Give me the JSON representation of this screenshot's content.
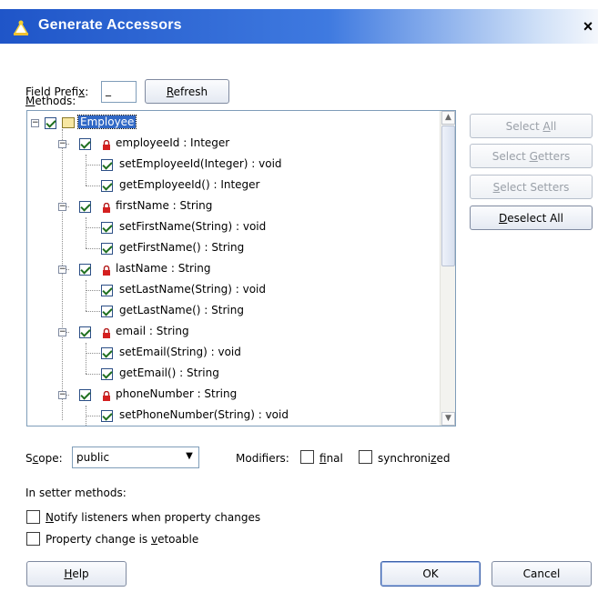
{
  "window": {
    "title": "Generate Accessors",
    "close_glyph": "×"
  },
  "field_prefix": {
    "label_before": "Field Prefi",
    "label_mn": "x",
    "label_after": ":",
    "value": "_"
  },
  "refresh_button": {
    "mn": "R",
    "rest": "efresh"
  },
  "methods_label": {
    "mn": "M",
    "rest": "ethods:"
  },
  "tree": {
    "root": {
      "label": "Employee",
      "checked": true
    },
    "fields": [
      {
        "label": "employeeId : Integer",
        "methods": [
          "setEmployeeId(Integer) : void",
          "getEmployeeId() : Integer"
        ]
      },
      {
        "label": "firstName : String",
        "methods": [
          "setFirstName(String) : void",
          "getFirstName() : String"
        ]
      },
      {
        "label": "lastName : String",
        "methods": [
          "setLastName(String) : void",
          "getLastName() : String"
        ]
      },
      {
        "label": "email : String",
        "methods": [
          "setEmail(String) : void",
          "getEmail() : String"
        ]
      },
      {
        "label": "phoneNumber : String",
        "methods": [
          "setPhoneNumber(String) : void"
        ]
      }
    ]
  },
  "side_buttons": {
    "select_all": {
      "before": "Select ",
      "mn": "A",
      "after": "ll"
    },
    "select_getters": {
      "before": "Select ",
      "mn": "G",
      "after": "etters"
    },
    "select_setters": {
      "before": "",
      "mn": "S",
      "after": "elect Setters"
    },
    "deselect_all": {
      "before": "",
      "mn": "D",
      "after": "eselect All"
    }
  },
  "scope": {
    "label_before": "S",
    "label_mn": "c",
    "label_after": "ope:",
    "value": "public"
  },
  "modifiers": {
    "label": "Modifiers:",
    "final": {
      "mn": "f",
      "rest": "inal",
      "checked": false
    },
    "synchronized": {
      "before": "synchroni",
      "mn": "z",
      "after": "ed",
      "checked": false
    }
  },
  "setter_section": {
    "label": "In setter methods:",
    "notify": {
      "mn": "N",
      "rest": "otify listeners when property changes",
      "checked": false
    },
    "vetoable": {
      "before": "Property change is ",
      "mn": "v",
      "after": "etoable",
      "checked": false
    }
  },
  "footer": {
    "help": {
      "mn": "H",
      "rest": "elp"
    },
    "ok": "OK",
    "cancel": "Cancel"
  },
  "colors": {
    "title_start": "#1f55c8",
    "title_end": "#f4f7fc",
    "selection": "#3169c6"
  }
}
